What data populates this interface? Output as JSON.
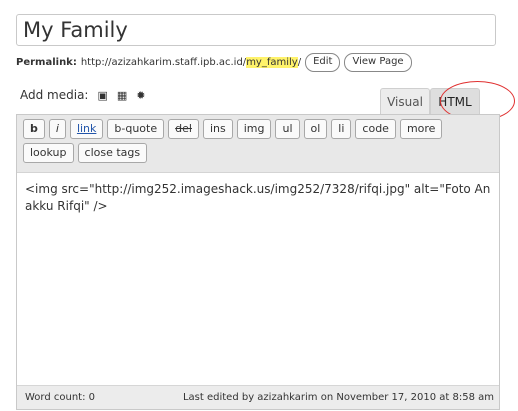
{
  "post": {
    "title": "My Family"
  },
  "permalink": {
    "label": "Permalink:",
    "base_url": "http://azizahkarim.staff.ipb.ac.id/",
    "slug": "my_family",
    "trailing": "/",
    "edit_label": "Edit",
    "view_label": "View Page"
  },
  "media": {
    "label": "Add media:",
    "icons": [
      "add-image-icon",
      "add-gallery-icon",
      "add-media-icon"
    ]
  },
  "tabs": {
    "visual": "Visual",
    "html": "HTML",
    "active": "html"
  },
  "quicktags": {
    "row1": [
      "b",
      "i",
      "link",
      "b-quote",
      "del",
      "ins",
      "img",
      "ul",
      "ol",
      "li",
      "code",
      "more"
    ],
    "row2": [
      "lookup",
      "close tags"
    ]
  },
  "content": {
    "text": "<img src=\"http://img252.imageshack.us/img252/7328/rifqi.jpg\" alt=\"Foto Anakku Rifqi\" />"
  },
  "status": {
    "word_count": "Word count: 0",
    "last_edited": "Last edited by azizahkarim on November 17, 2010 at 8:58 am"
  },
  "colors": {
    "slug_highlight": "#fff36b",
    "annotation_circle": "#e03030"
  }
}
